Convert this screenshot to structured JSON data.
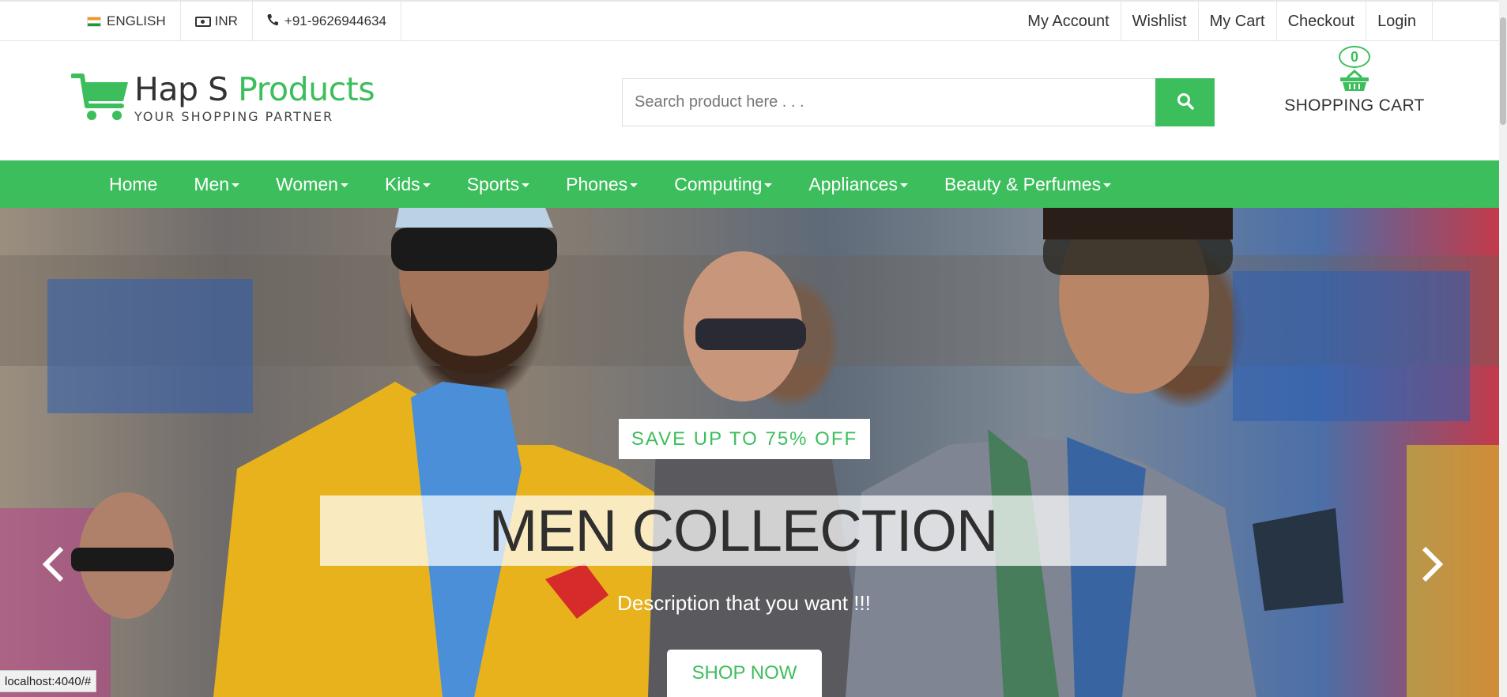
{
  "topbar": {
    "language": "ENGLISH",
    "currency": "INR",
    "phone": "+91-9626944634",
    "links": [
      "My Account",
      "Wishlist",
      "My Cart",
      "Checkout",
      "Login"
    ]
  },
  "header": {
    "logo": {
      "name_part1": "Hap S ",
      "name_part2": "Products",
      "tagline": "YOUR SHOPPING PARTNER"
    },
    "search": {
      "placeholder": "Search product here . . .",
      "value": ""
    },
    "cart": {
      "count": "0",
      "label": "SHOPPING CART"
    }
  },
  "nav": {
    "items": [
      "Home",
      "Men",
      "Women",
      "Kids",
      "Sports",
      "Phones",
      "Computing",
      "Appliances",
      "Beauty & Perfumes"
    ]
  },
  "hero": {
    "badge": "SAVE UP TO 75% OFF",
    "headline": "MEN COLLECTION",
    "description": "Description that you want !!!",
    "cta": "SHOP NOW"
  },
  "status_bar": {
    "url": "localhost:4040/#"
  },
  "colors": {
    "accent": "#3dbe5d",
    "text": "#333333",
    "border": "#e6e6e6"
  },
  "icons": [
    "flag-india-icon",
    "money-icon",
    "phone-icon",
    "cart-logo-icon",
    "search-icon",
    "basket-icon",
    "chevron-left-icon",
    "chevron-right-icon"
  ]
}
